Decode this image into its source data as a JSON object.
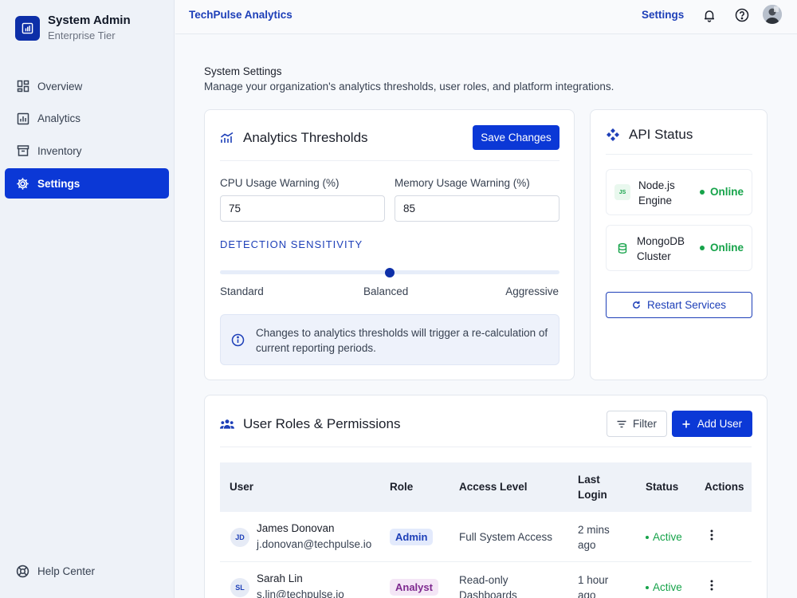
{
  "sidebar": {
    "brand_title": "System Admin",
    "brand_subtitle": "Enterprise Tier",
    "items": [
      {
        "label": "Overview",
        "icon": "dashboard-icon",
        "active": false
      },
      {
        "label": "Analytics",
        "icon": "bar-chart-icon",
        "active": false
      },
      {
        "label": "Inventory",
        "icon": "inventory-icon",
        "active": false
      },
      {
        "label": "Settings",
        "icon": "gear-icon",
        "active": true
      }
    ],
    "help_label": "Help Center"
  },
  "topbar": {
    "app_title": "TechPulse Analytics",
    "settings_link": "Settings"
  },
  "page": {
    "title": "System Settings",
    "subtitle": "Manage your organization's analytics thresholds, user roles, and platform integrations."
  },
  "thresholds": {
    "title": "Analytics Thresholds",
    "save_label": "Save Changes",
    "cpu_label": "CPU Usage Warning (%)",
    "cpu_value": "75",
    "memory_label": "Memory Usage Warning (%)",
    "memory_value": "85",
    "sensitivity_label": "DETECTION SENSITIVITY",
    "sensitivity_level": 0.5,
    "sensitivity_options": [
      "Standard",
      "Balanced",
      "Aggressive"
    ],
    "info_text": "Changes to analytics thresholds will trigger a re-calculation of current reporting periods."
  },
  "api_status": {
    "title": "API Status",
    "services": [
      {
        "name": "Node.js Engine",
        "icon_text": "JS",
        "status": "Online"
      },
      {
        "name": "MongoDB Cluster",
        "icon_text": "",
        "status": "Online"
      }
    ],
    "restart_label": "Restart Services"
  },
  "users": {
    "title": "User Roles & Permissions",
    "filter_label": "Filter",
    "add_label": "Add User",
    "columns": [
      "User",
      "Role",
      "Access Level",
      "Last Login",
      "Status",
      "Actions"
    ],
    "rows": [
      {
        "initials": "JD",
        "name": "James Donovan",
        "email": "j.donovan@techpulse.io",
        "role": "Admin",
        "access": "Full System Access",
        "last_login": "2 mins ago",
        "status": "Active"
      },
      {
        "initials": "SL",
        "name": "Sarah Lin",
        "email": "s.lin@techpulse.io",
        "role": "Analyst",
        "access": "Read-only Dashboards",
        "last_login": "1 hour ago",
        "status": "Active"
      }
    ]
  },
  "colors": {
    "primary": "#0b38d6",
    "link": "#1d3fb8",
    "success": "#16a34a",
    "sidebar_bg": "#eef2f8"
  }
}
